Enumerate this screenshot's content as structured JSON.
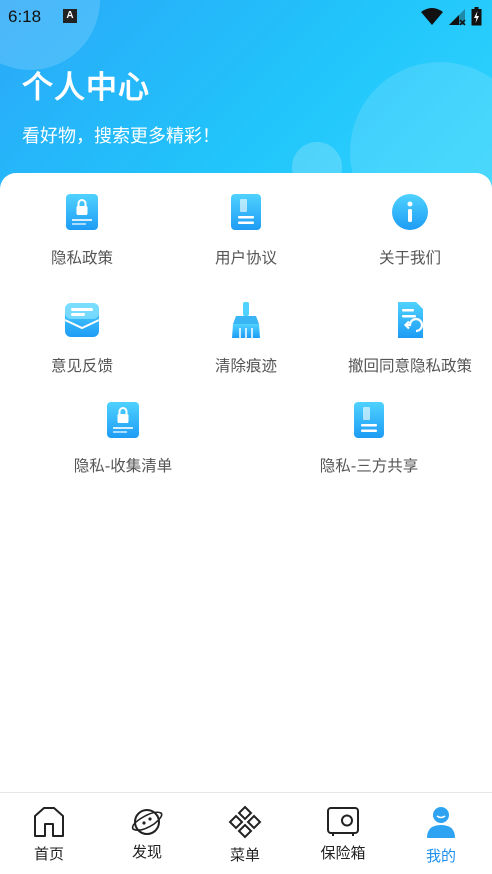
{
  "status_bar": {
    "time": "6:18",
    "notification_icon_letter": "A"
  },
  "header": {
    "title": "个人中心",
    "subtitle": "看好物，搜索更多精彩！"
  },
  "grid": [
    {
      "label": "隐私政策",
      "icon": "lock-document-icon"
    },
    {
      "label": "用户协议",
      "icon": "document-icon"
    },
    {
      "label": "关于我们",
      "icon": "info-icon"
    },
    {
      "label": "意见反馈",
      "icon": "message-box-icon"
    },
    {
      "label": "清除痕迹",
      "icon": "broom-icon"
    },
    {
      "label": "撤回同意隐私政策",
      "icon": "undo-document-icon"
    },
    {
      "label": "隐私-收集清单",
      "icon": "lock-document-icon"
    },
    {
      "label": "隐私-三方共享",
      "icon": "document-icon"
    }
  ],
  "tabbar": [
    {
      "label": "首页",
      "icon": "home-icon",
      "active": false
    },
    {
      "label": "发现",
      "icon": "planet-icon",
      "active": false
    },
    {
      "label": "菜单",
      "icon": "menu-diamond-icon",
      "active": false
    },
    {
      "label": "保险箱",
      "icon": "safe-icon",
      "active": false
    },
    {
      "label": "我的",
      "icon": "user-icon",
      "active": true
    }
  ],
  "colors": {
    "accent": "#1e90ef",
    "header_start": "#2aa8f8",
    "header_end": "#31d6fc",
    "icon_gradient_top": "#4fd2ff",
    "icon_gradient_bottom": "#1e9cf5"
  }
}
